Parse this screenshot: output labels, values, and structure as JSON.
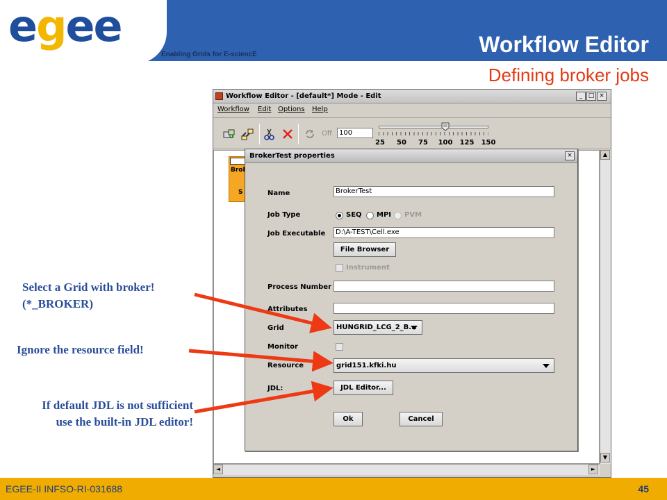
{
  "slide": {
    "logo_text": "egee",
    "tagline": "Enabling Grids for E-sciencE",
    "title": "Workflow Editor",
    "subtitle": "Defining broker jobs",
    "footer": "EGEE-II INFSO-RI-031688",
    "page_number": "45"
  },
  "app": {
    "window_title": "Workflow Editor - [default*] Mode - Edit",
    "window_buttons": [
      "_",
      "□",
      "×"
    ],
    "menu": [
      "Workflow",
      "Edit",
      "Options",
      "Help"
    ],
    "toolbar": {
      "off_label": "Off",
      "zoom_value": "100",
      "zoom_ticks": [
        "25",
        "50",
        "75",
        "100",
        "125",
        "150"
      ],
      "zoom_level": 100
    },
    "canvas": {
      "job_label": "Brok",
      "job_sub": "S"
    },
    "scroll_arrows": {
      "up": "▲",
      "down": "▼",
      "left": "◄",
      "right": "►"
    }
  },
  "dialog": {
    "title": "BrokerTest properties",
    "close": "×",
    "labels": {
      "name": "Name",
      "job_type": "Job Type",
      "job_executable": "Job Executable",
      "process_number": "Process Number",
      "attributes": "Attributes",
      "grid": "Grid",
      "monitor": "Monitor",
      "resource": "Resource",
      "jdl": "JDL:"
    },
    "name_value": "BrokerTest",
    "job_type_options": [
      "SEQ",
      "MPI",
      "PVM"
    ],
    "job_type_selected": "SEQ",
    "job_executable_value": "D:\\A-TEST\\Cell.exe",
    "file_browser_button": "File Browser",
    "instrument_label": "Instrument",
    "process_number_value": "",
    "attributes_value": "",
    "grid_value": "HUNGRID_LCG_2_B...",
    "resource_value": "grid151.kfki.hu",
    "jdl_editor_button": "JDL Editor...",
    "ok_button": "Ok",
    "cancel_button": "Cancel"
  },
  "annotations": {
    "grid_note_line1": "Select a Grid with broker!",
    "grid_note_line2": "(*_BROKER)",
    "resource_note": "Ignore the resource field!",
    "jdl_note_line1": "If default JDL is not sufficient",
    "jdl_note_line2": "use the built-in JDL editor!"
  },
  "colors": {
    "header_blue": "#2e61b0",
    "subtitle_red": "#e33b16",
    "footer_gold": "#f0ac00",
    "annotation_blue": "#2b4e9a",
    "arrow_red": "#ee3a14",
    "job_node_orange": "#f5a623"
  }
}
